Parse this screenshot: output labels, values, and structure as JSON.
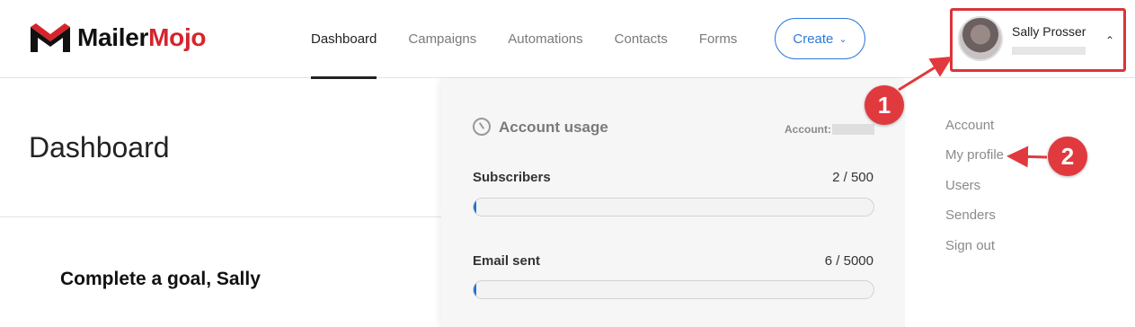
{
  "header": {
    "logo": {
      "part1": "Mailer",
      "part2": "Mojo"
    },
    "nav": [
      {
        "label": "Dashboard",
        "active": true
      },
      {
        "label": "Campaigns",
        "active": false
      },
      {
        "label": "Automations",
        "active": false
      },
      {
        "label": "Contacts",
        "active": false
      },
      {
        "label": "Forms",
        "active": false
      }
    ],
    "create_label": "Create",
    "user": {
      "name": "Sally Prosser"
    }
  },
  "main": {
    "title": "Dashboard",
    "goal_title": "Complete a goal, Sally"
  },
  "usage": {
    "title": "Account usage",
    "account_label": "Account:",
    "subscribers": {
      "label": "Subscribers",
      "value": "2 / 500",
      "fraction": 0.004
    },
    "emails": {
      "label": "Email sent",
      "value": "6 / 5000",
      "fraction": 0.0012
    }
  },
  "menu": {
    "items": [
      "Account",
      "My profile",
      "Users",
      "Senders",
      "Sign out"
    ]
  },
  "annotations": {
    "badge1": "1",
    "badge2": "2"
  },
  "colors": {
    "accent": "#2f7bd8",
    "brand_red": "#d6242d",
    "annotation": "#e0393e",
    "progress": "#1e6fd9"
  }
}
